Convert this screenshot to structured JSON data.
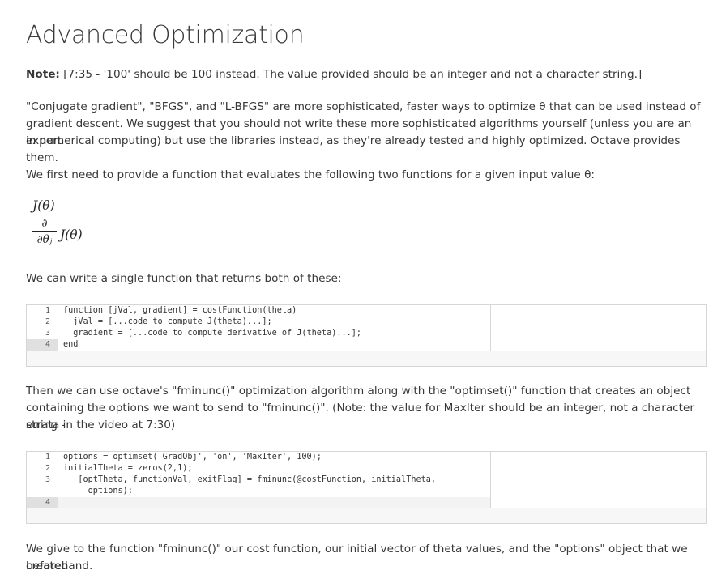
{
  "title": "Advanced Optimization",
  "note": {
    "label": "Note:",
    "text": " [7:35 - '100' should be 100 instead. The value provided should be an integer and not a character string.]"
  },
  "paragraphs": {
    "intro_1": "\"Conjugate gradient\", \"BFGS\", and \"L-BFGS\" are more sophisticated, faster ways to optimize θ that can be used instead of",
    "intro_2": "gradient descent. We suggest that you should not write these more sophisticated algorithms yourself (unless you are an expert",
    "intro_3": "in numerical computing) but use the libraries instead, as they're already tested and highly optimized. Octave provides them.",
    "first_need": "We first need to provide a function that evaluates the following two functions for a given input value θ:",
    "single_function": "We can write a single function that returns both of these:",
    "then_1": "Then we can use octave's \"fminunc()\" optimization algorithm along with the \"optimset()\" function that creates an object",
    "then_2": "containing the options we want to send to \"fminunc()\". (Note: the value for MaxIter should be an integer, not a character string -",
    "then_3": "errata in the video at 7:30)",
    "give_1": "We give to the function \"fminunc()\" our cost function, our initial vector of theta values, and the \"options\" object that we created",
    "give_2": "beforehand."
  },
  "math": {
    "j_theta": "J(θ)",
    "partial_num": "∂",
    "partial_den": "∂θⱼ",
    "j_theta_2": "J(θ)"
  },
  "code_block_1": {
    "line_numbers": [
      "1",
      "2",
      "3",
      "4"
    ],
    "lines": [
      "function [jVal, gradient] = costFunction(theta)",
      "  jVal = [...code to compute J(theta)...];",
      "  gradient = [...code to compute derivative of J(theta)...];",
      "end"
    ]
  },
  "code_block_2": {
    "line_numbers": [
      "1",
      "2",
      "3",
      "",
      "4"
    ],
    "lines": [
      "options = optimset('GradObj', 'on', 'MaxIter', 100);",
      "initialTheta = zeros(2,1);",
      "   [optTheta, functionVal, exitFlag] = fminunc(@costFunction, initialTheta,",
      "     options);",
      ""
    ]
  }
}
